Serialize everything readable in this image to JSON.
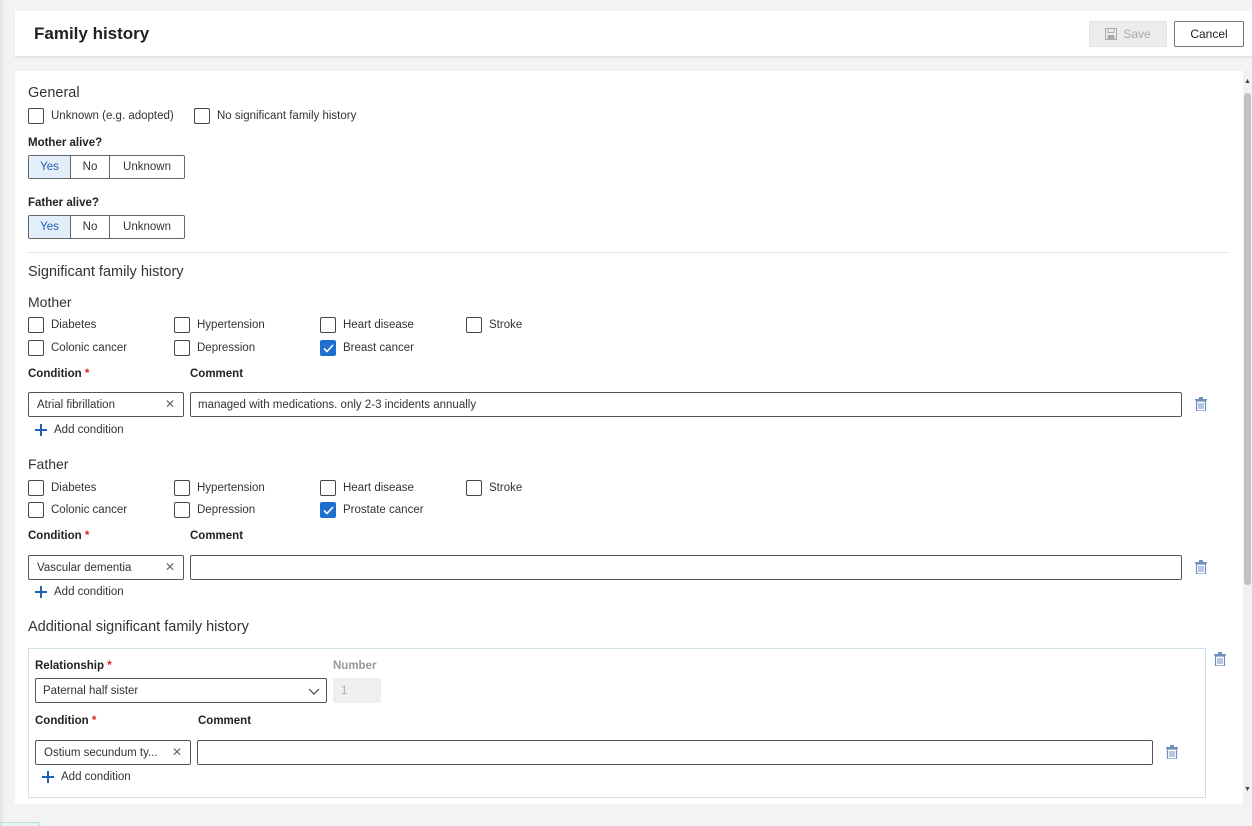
{
  "header": {
    "title": "Family history",
    "save_label": "Save",
    "cancel_label": "Cancel"
  },
  "general": {
    "title": "General",
    "unknown_label": "Unknown (e.g. adopted)",
    "no_sig_label": "No significant family history",
    "mother_alive": {
      "label": "Mother alive?",
      "options": [
        "Yes",
        "No",
        "Unknown"
      ],
      "selected": "Yes"
    },
    "father_alive": {
      "label": "Father alive?",
      "options": [
        "Yes",
        "No",
        "Unknown"
      ],
      "selected": "Yes"
    }
  },
  "significant": {
    "title": "Significant family history",
    "mother": {
      "title": "Mother",
      "checks": [
        {
          "label": "Diabetes",
          "checked": false
        },
        {
          "label": "Hypertension",
          "checked": false
        },
        {
          "label": "Heart disease",
          "checked": false
        },
        {
          "label": "Stroke",
          "checked": false
        },
        {
          "label": "Colonic cancer",
          "checked": false
        },
        {
          "label": "Depression",
          "checked": false
        },
        {
          "label": "Breast cancer",
          "checked": true
        }
      ],
      "condition_label": "Condition",
      "comment_label": "Comment",
      "condition_value": "Atrial fibrillation",
      "comment_value": "managed with medications. only 2-3 incidents annually",
      "add_condition": "Add condition"
    },
    "father": {
      "title": "Father",
      "checks": [
        {
          "label": "Diabetes",
          "checked": false
        },
        {
          "label": "Hypertension",
          "checked": false
        },
        {
          "label": "Heart disease",
          "checked": false
        },
        {
          "label": "Stroke",
          "checked": false
        },
        {
          "label": "Colonic cancer",
          "checked": false
        },
        {
          "label": "Depression",
          "checked": false
        },
        {
          "label": "Prostate cancer",
          "checked": true
        }
      ],
      "condition_label": "Condition",
      "comment_label": "Comment",
      "condition_value": "Vascular dementia",
      "comment_value": "",
      "add_condition": "Add condition"
    }
  },
  "additional": {
    "title": "Additional significant family history",
    "relationship_label": "Relationship",
    "relationship_value": "Paternal half sister",
    "number_label": "Number",
    "number_value": "1",
    "condition_label": "Condition",
    "comment_label": "Comment",
    "condition_value": "Ostium secundum ty...",
    "comment_value": "",
    "add_condition": "Add condition"
  },
  "colors": {
    "accent": "#1f6fd1",
    "selected_bg": "#e3eefb",
    "required": "#d22222"
  }
}
